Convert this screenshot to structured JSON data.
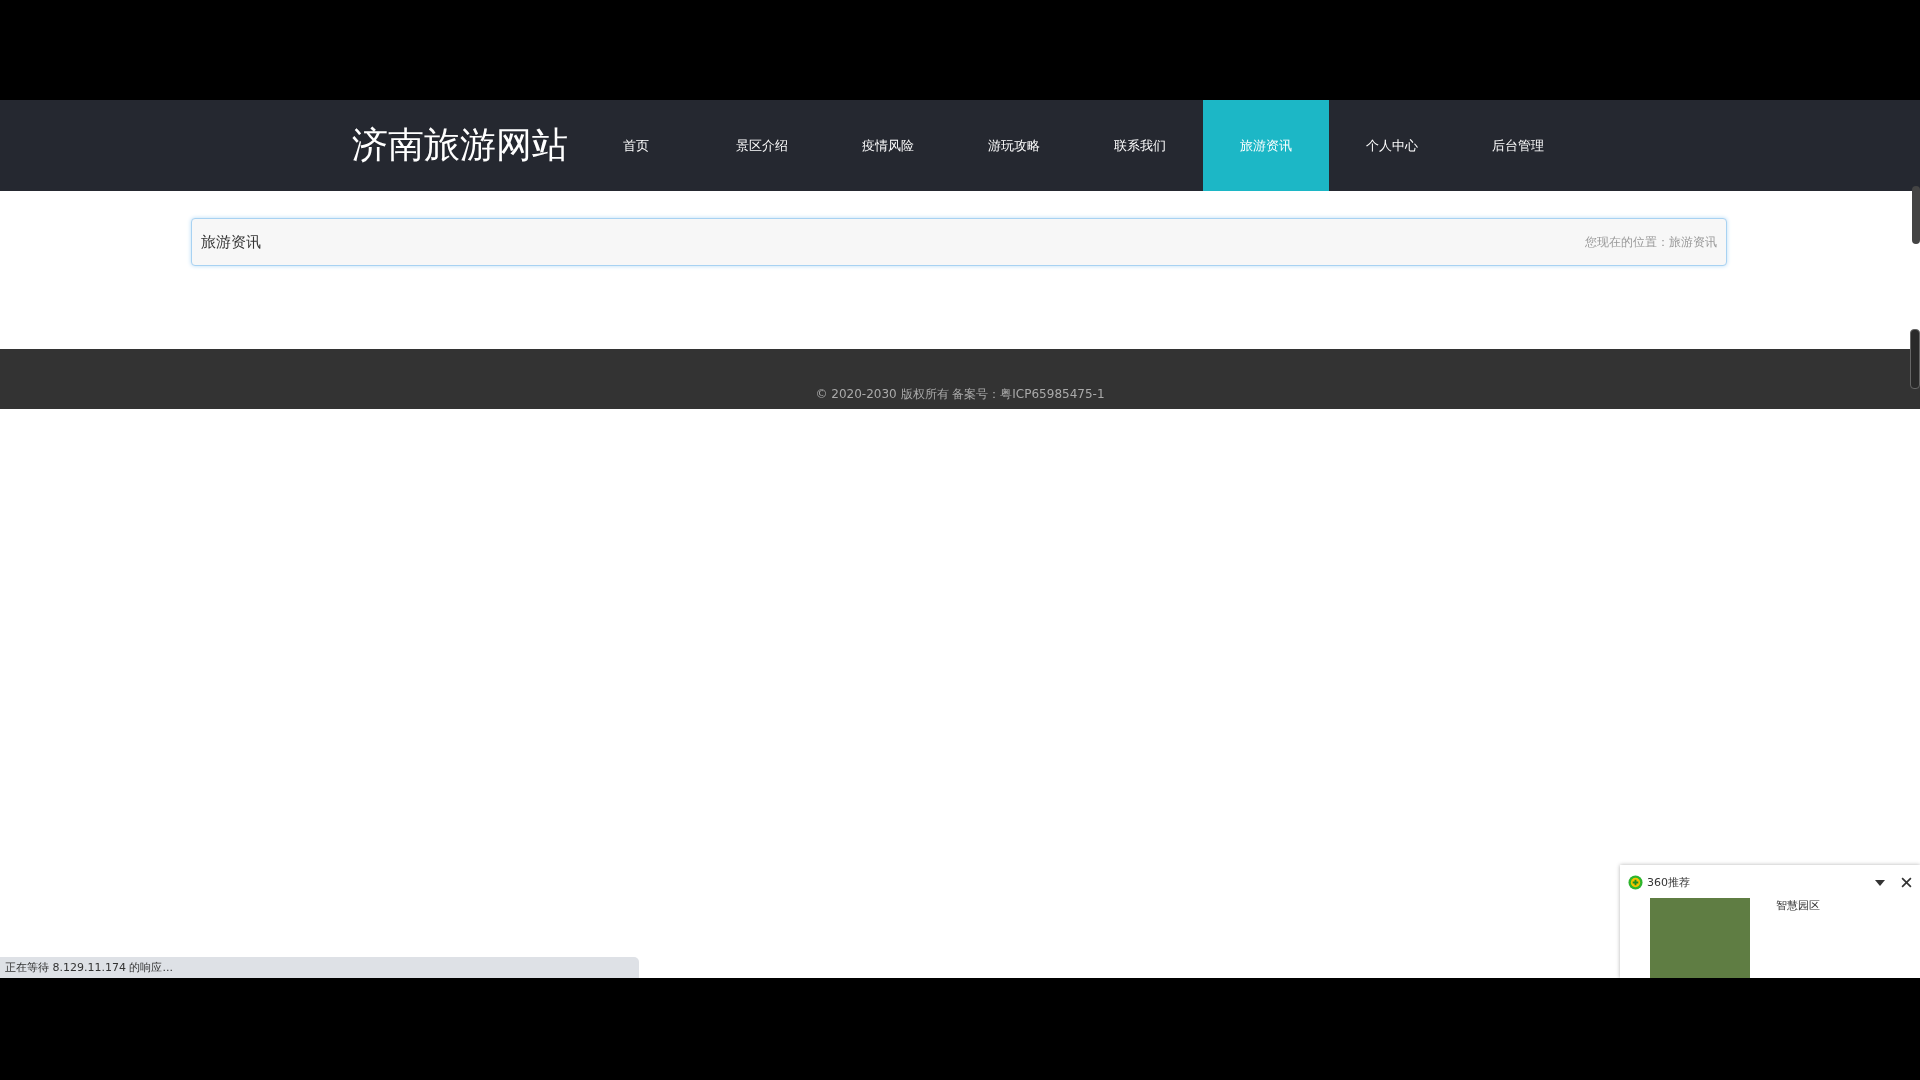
{
  "site_title": "济南旅游网站",
  "nav": [
    {
      "label": "首页",
      "selected": false
    },
    {
      "label": "景区介绍",
      "selected": false
    },
    {
      "label": "疫情风险",
      "selected": false
    },
    {
      "label": "游玩攻略",
      "selected": false
    },
    {
      "label": "联系我们",
      "selected": false
    },
    {
      "label": "旅游资讯",
      "selected": true
    },
    {
      "label": "个人中心",
      "selected": false
    },
    {
      "label": "后台管理",
      "selected": false
    }
  ],
  "panel": {
    "title": "旅游资讯",
    "breadcrumb": "您现在的位置：旅游资讯"
  },
  "footer": "© 2020-2030 版权所有 备案号：粤ICP65985475-1",
  "status_bar": "正在等待 8.129.11.174 的响应...",
  "popup": {
    "title": "360推荐",
    "item_title": "智慧园区"
  }
}
